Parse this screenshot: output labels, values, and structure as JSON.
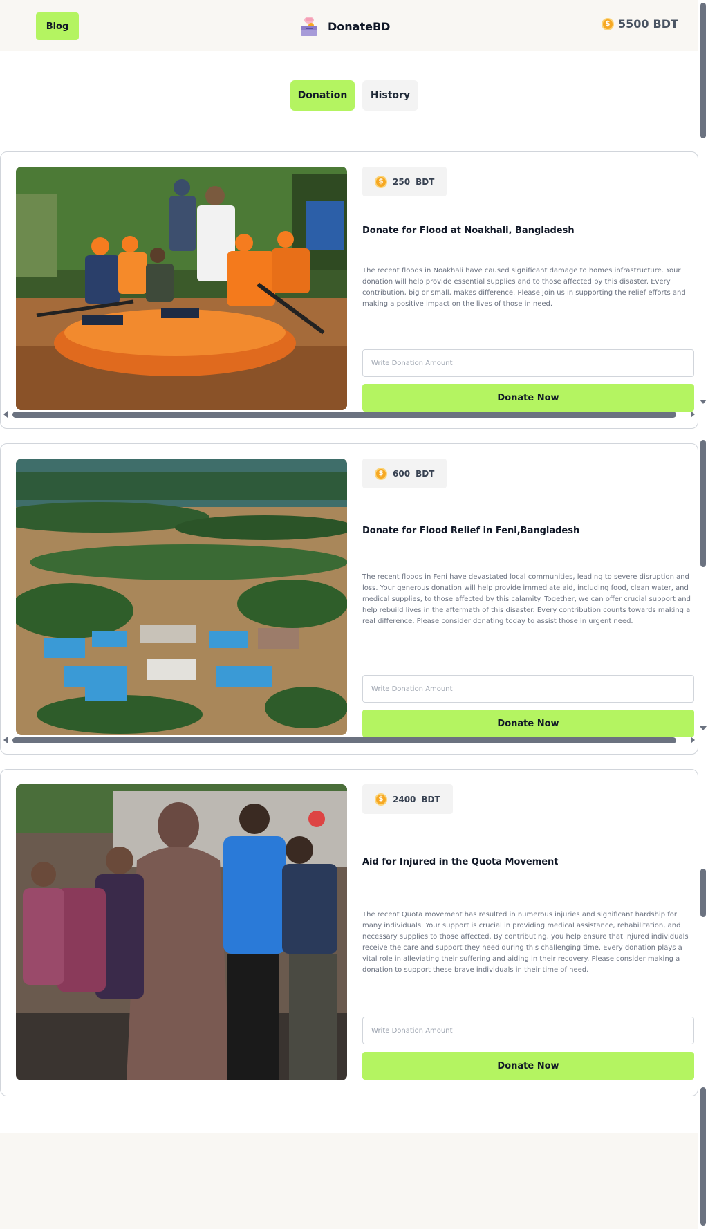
{
  "header": {
    "blog_label": "Blog",
    "brand_name": "DonateBD",
    "balance_amount": "5500",
    "balance_currency": "BDT"
  },
  "tabs": [
    {
      "label": "Donation",
      "active": true
    },
    {
      "label": "History",
      "active": false
    }
  ],
  "cards": [
    {
      "amount": "250",
      "currency": "BDT",
      "title": "Donate for Flood at Noakhali, Bangladesh",
      "description": "The recent floods in Noakhali have caused significant damage to homes infrastructure. Your donation will help provide essential supplies and to those affected by this disaster. Every contribution, big or small, makes difference. Please join us in supporting the relief efforts and making a positive impact on the lives of those in need.",
      "input_placeholder": "Write Donation Amount",
      "button_label": "Donate Now"
    },
    {
      "amount": "600",
      "currency": "BDT",
      "title": "Donate for Flood Relief in Feni,Bangladesh",
      "description": "The recent floods in Feni have devastated local communities, leading to severe disruption and loss. Your generous donation will help provide immediate aid, including food, clean water, and medical supplies, to those affected by this calamity. Together, we can offer crucial support and help rebuild lives in the aftermath of this disaster. Every contribution counts towards making a real difference. Please consider donating today to assist those in urgent need.",
      "input_placeholder": "Write Donation Amount",
      "button_label": "Donate Now"
    },
    {
      "amount": "2400",
      "currency": "BDT",
      "title": "Aid for Injured in the Quota Movement",
      "description": "The recent Quota movement has resulted in numerous injuries and significant hardship for many individuals. Your support is crucial in providing medical assistance, rehabilitation, and necessary supplies to those affected. By contributing, you help ensure that injured individuals receive the care and support they need during this challenging time. Every donation plays a vital role in alleviating their suffering and aiding in their recovery. Please consider making a donation to support these brave individuals in their time of need.",
      "input_placeholder": "Write Donation Amount",
      "button_label": "Donate Now"
    }
  ],
  "colors": {
    "accent": "#b4f461",
    "header_bg": "#f9f7f3",
    "coin": "#f6a823"
  }
}
